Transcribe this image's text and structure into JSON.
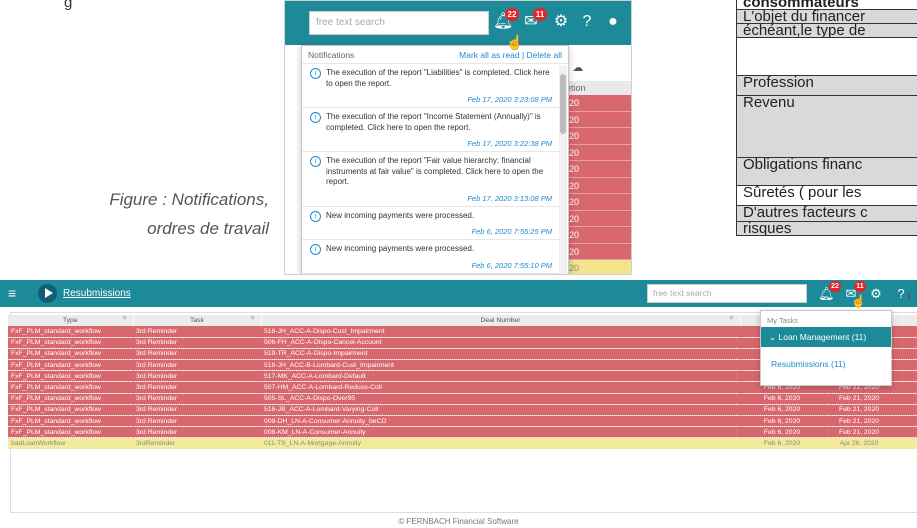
{
  "doc": {
    "fragment_top": "g",
    "caption_line1": "Figure : Notifications,",
    "caption_line2": "ordres de travail",
    "table_rows": [
      {
        "text": "consommateurs",
        "style": "hdr"
      },
      {
        "text": "L'objet du financer",
        "style": "grey"
      },
      {
        "text": "échéant,le type de",
        "style": "grey"
      },
      {
        "text": "",
        "style": "white"
      },
      {
        "text": "Profession",
        "style": "grey"
      },
      {
        "text": "Revenu",
        "style": "grey"
      },
      {
        "text": "Obligations financ",
        "style": "grey"
      },
      {
        "text": "Sûretés ( pour les",
        "style": "white"
      },
      {
        "text": "D'autres facteurs c",
        "style": "grey"
      },
      {
        "text": "risques",
        "style": "grey"
      }
    ]
  },
  "top_screenshot": {
    "search_placeholder": "free text search",
    "bell_badge": "22",
    "tasks_badge": "11",
    "notifications": {
      "header": "Notifications",
      "links": "Mark all as read | Delete all",
      "items": [
        {
          "message": "The execution of the report \"Liabilities\" is completed. Click here to open the report.",
          "time": "Feb 17, 2020 3:23:08 PM"
        },
        {
          "message": "The execution of the report \"Income Statement (Annually)\" is completed. Click here to open the report.",
          "time": "Feb 17, 2020 3:22:38 PM"
        },
        {
          "message": "The execution of the report \"Fair value hierarchy: financial instruments at fair value\" is completed. Click here to open the report.",
          "time": "Feb 17, 2020 3:13:08 PM"
        },
        {
          "message": "New incoming payments were processed.",
          "time": "Feb 6, 2020 7:55:25 PM"
        },
        {
          "message": "New incoming payments were processed.",
          "time": "Feb 6, 2020 7:55:10 PM"
        },
        {
          "message": "New incoming payments were processed.",
          "time": ""
        }
      ]
    },
    "behind_header": "pletion",
    "behind_values": [
      "2020",
      "2020",
      "2020",
      "2020",
      "2020",
      "2020",
      "2020",
      "2020",
      "2020",
      "2020",
      "2020"
    ]
  },
  "app": {
    "title": "Resubmissions",
    "search_placeholder": "free text search",
    "bell_badge": "22",
    "tasks_badge": "11",
    "columns": [
      "Type",
      "Task",
      "Deal Number",
      "Re",
      "",
      ""
    ],
    "rows": [
      {
        "type": "FxF_PLM_standard_workflow",
        "task": "3rd Reminder",
        "deal": "518-JH_ACC-A-Dispo-Cust_Impairment",
        "d1": "Feb 6, 2020",
        "d2": "Feb 21, 2020",
        "color": "red"
      },
      {
        "type": "FxF_PLM_standard_workflow",
        "task": "3rd Reminder",
        "deal": "506-FH_ACC-A-Dispo-Cancel-Account",
        "d1": "Feb 6, 2020",
        "d2": "Feb 21, 2020",
        "color": "red"
      },
      {
        "type": "FxF_PLM_standard_workflow",
        "task": "3rd Reminder",
        "deal": "519-TR_ACC-A-Dispo-Impairment",
        "d1": "Feb 6, 2020",
        "d2": "Feb 21, 2020",
        "color": "red"
      },
      {
        "type": "FxF_PLM_standard_workflow",
        "task": "3rd Reminder",
        "deal": "518-JH_ACC-B-Lombard-Cust_Impairment",
        "d1": "Feb 6, 2020",
        "d2": "Feb 21, 2020",
        "color": "red"
      },
      {
        "type": "FxF_PLM_standard_workflow",
        "task": "3rd Reminder",
        "deal": "517-MK_ACC-A-Lombard-Default",
        "d1": "Feb 6, 2020",
        "d2": "Feb 21, 2020",
        "color": "red"
      },
      {
        "type": "FxF_PLM_standard_workflow",
        "task": "3rd Reminder",
        "deal": "507-HM_ACC-A-Lombard-Reduce-Coll",
        "d1": "Feb 6, 2020",
        "d2": "Feb 21, 2020",
        "color": "red"
      },
      {
        "type": "FxF_PLM_standard_workflow",
        "task": "3rd Reminder",
        "deal": "505-SL_ACC-A-Dispo-Over95",
        "d1": "Feb 6, 2020",
        "d2": "Feb 21, 2020",
        "color": "red"
      },
      {
        "type": "FxF_PLM_standard_workflow",
        "task": "3rd Reminder",
        "deal": "516-JB_ACC-A-Lombard-Varying-Coll",
        "d1": "Feb 6, 2020",
        "d2": "Feb 21, 2020",
        "color": "red"
      },
      {
        "type": "FxF_PLM_standard_workflow",
        "task": "3rd Reminder",
        "deal": "009-DH_LN-A-Consumer-Annuity_beCD",
        "d1": "Feb 6, 2020",
        "d2": "Feb 21, 2020",
        "color": "red"
      },
      {
        "type": "FxF_PLM_standard_workflow",
        "task": "3rd Reminder",
        "deal": "008-KM_LN-A-Consumer-Annuity",
        "d1": "Feb 6, 2020",
        "d2": "Feb 21, 2020",
        "color": "red"
      },
      {
        "type": "badLoanWorkflow",
        "task": "3rdReminder",
        "deal": "011-TS_LN-A-Mortgage-Annuity",
        "d1": "Feb 6, 2020",
        "d2": "Apr 26, 2020",
        "color": "yellow"
      }
    ],
    "tasks_dropdown": {
      "header": "My Tasks",
      "group": "Loan Management (11)",
      "item": "Resubmissions (11)"
    },
    "behind_dropdown": [
      "20",
      "20"
    ],
    "footer": "© FERNBACH Financial Software"
  }
}
